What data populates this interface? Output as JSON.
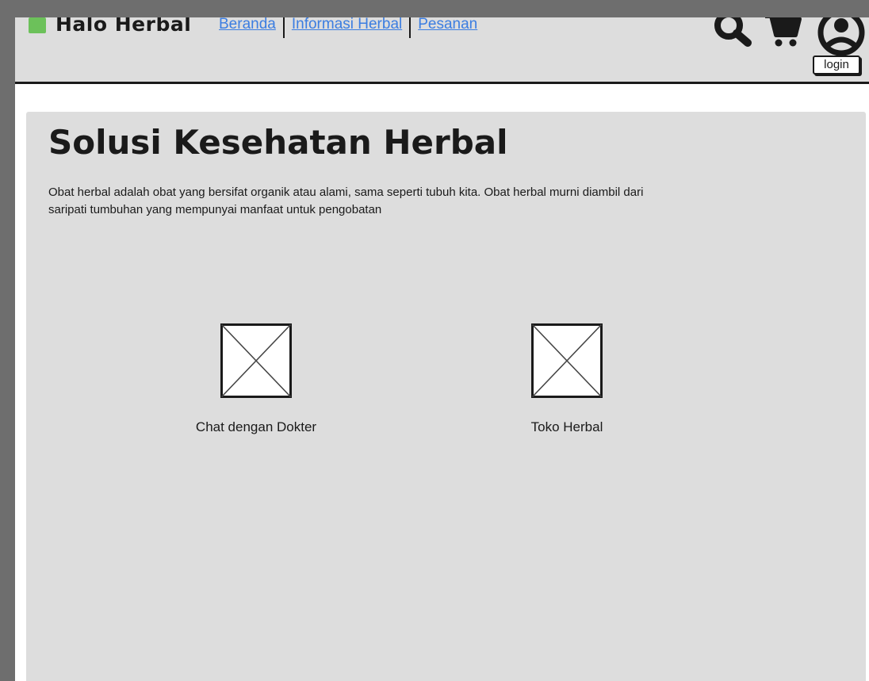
{
  "header": {
    "brand": "Halo Herbal",
    "nav": [
      {
        "label": "Beranda "
      },
      {
        "label": "Informasi Herbal "
      },
      {
        "label": "Pesanan"
      }
    ],
    "login_label": "login",
    "icons": [
      "search-icon",
      "cart-icon",
      "user-icon"
    ],
    "logo_color": "#6cc15a"
  },
  "main": {
    "title": "Solusi Kesehatan Herbal",
    "description": "Obat herbal adalah obat yang bersifat organik atau alami, sama seperti tubuh kita. Obat herbal murni diambil dari saripati tumbuhan yang mempunyai manfaat untuk pengobatan",
    "features": [
      {
        "label": "Chat dengan Dokter"
      },
      {
        "label": "Toko Herbal"
      }
    ]
  }
}
